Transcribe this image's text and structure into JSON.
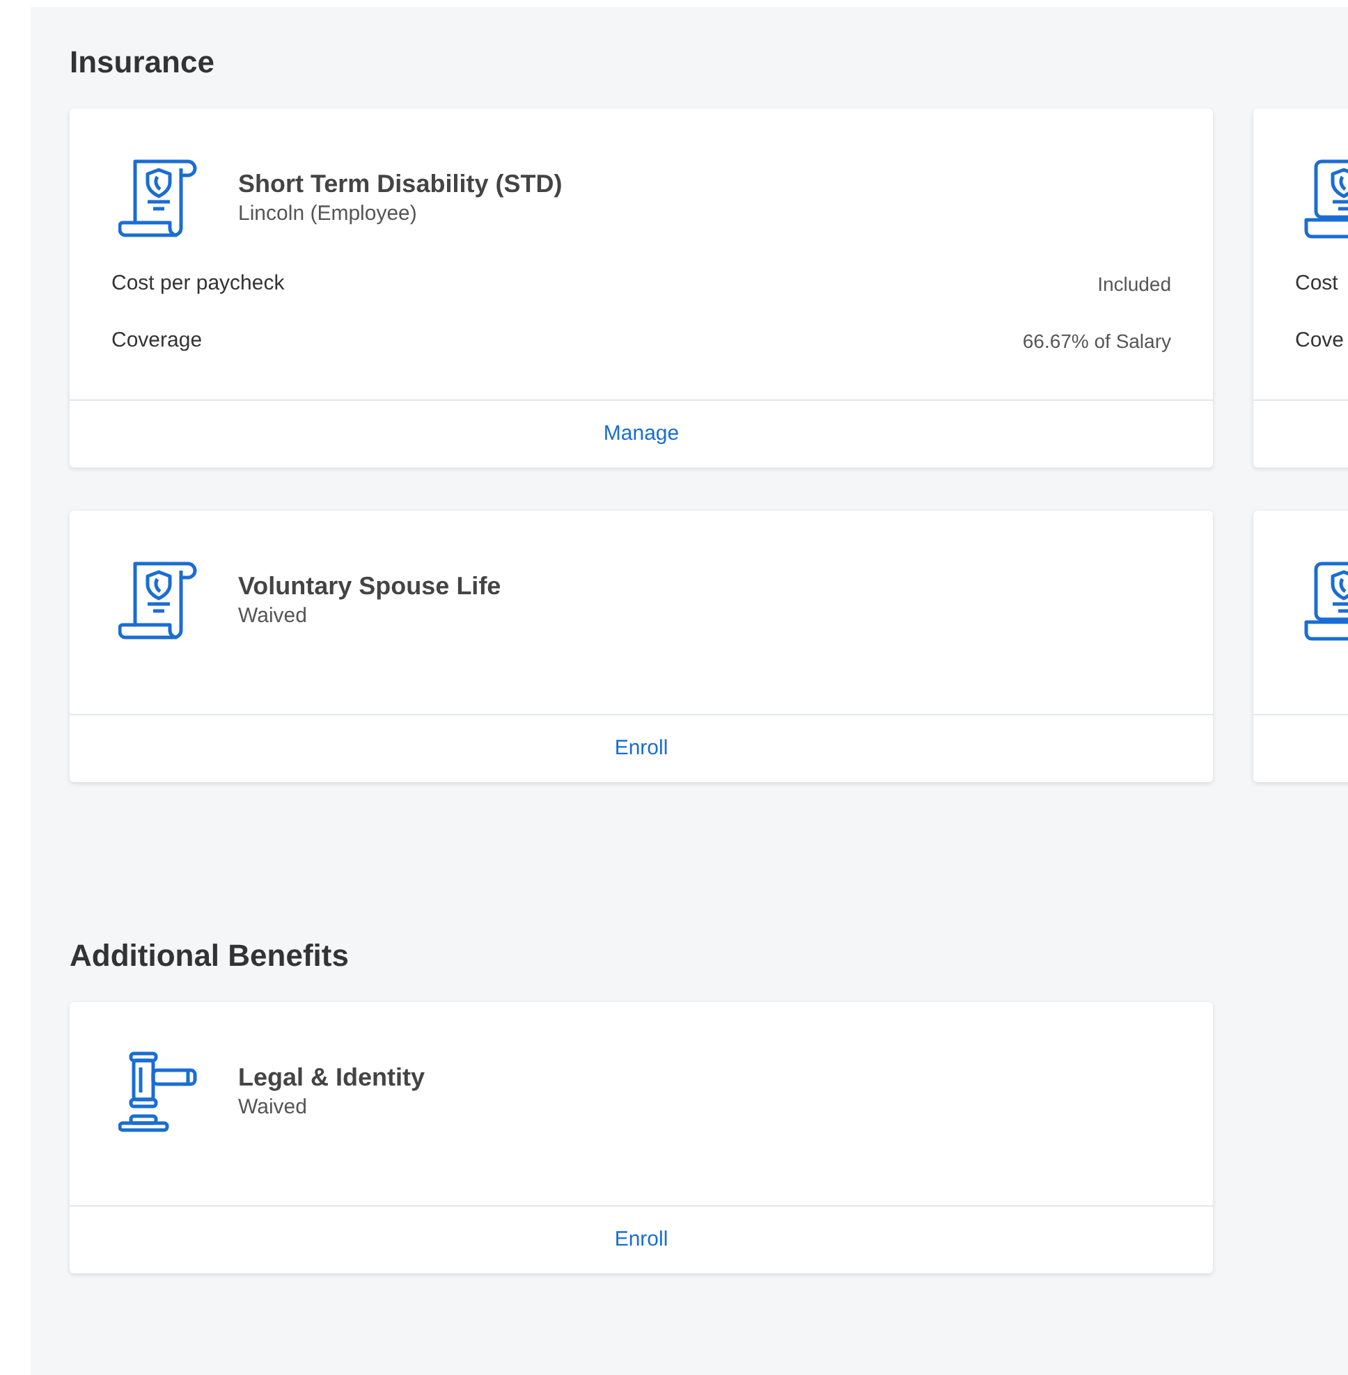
{
  "sections": [
    {
      "title": "Insurance",
      "cards": [
        {
          "kind": "scroll",
          "title": "Short Term Disability (STD)",
          "subtitle": "Lincoln (Employee)",
          "details": [
            {
              "label": "Cost per paycheck",
              "value": "Included"
            },
            {
              "label": "Coverage",
              "value": "66.67% of Salary"
            }
          ],
          "action": "Manage"
        },
        {
          "kind": "laptop",
          "details": [
            {
              "label": "Cost"
            },
            {
              "label": "Cove"
            }
          ]
        },
        {
          "kind": "scroll",
          "title": "Voluntary Spouse Life",
          "subtitle": "Waived",
          "action": "Enroll"
        },
        {
          "kind": "laptop"
        }
      ]
    },
    {
      "title": "Additional Benefits",
      "cards": [
        {
          "kind": "gavel",
          "title": "Legal & Identity",
          "subtitle": "Waived",
          "action": "Enroll"
        }
      ]
    }
  ]
}
